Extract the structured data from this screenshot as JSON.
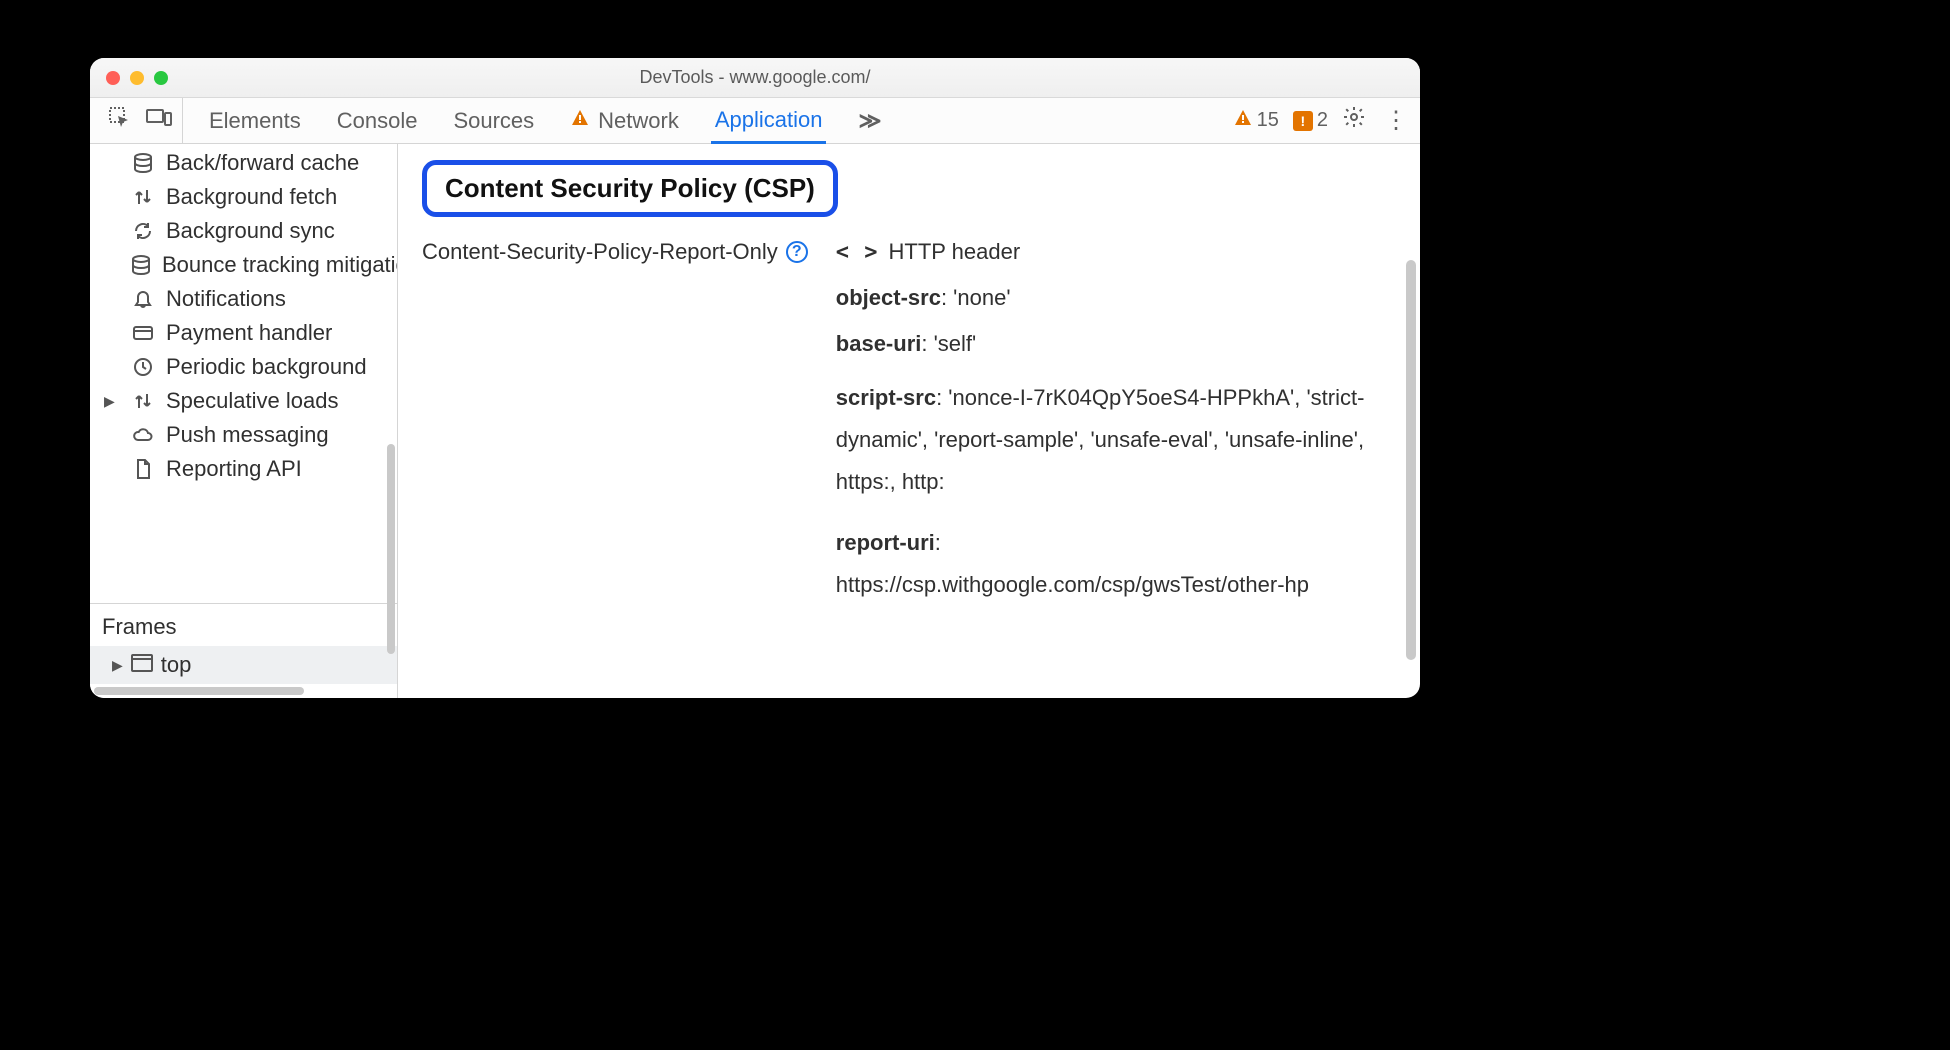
{
  "window": {
    "title": "DevTools - www.google.com/"
  },
  "tabstrip": {
    "tabs": [
      "Elements",
      "Console",
      "Sources",
      "Network",
      "Application"
    ],
    "active_index": 4,
    "overflow_glyph": "≫",
    "warn_count": "15",
    "issue_count": "2"
  },
  "sidebar": {
    "items": [
      {
        "icon": "database-icon",
        "label": "Back/forward cache"
      },
      {
        "icon": "updown-icon",
        "label": "Background fetch"
      },
      {
        "icon": "sync-icon",
        "label": "Background sync"
      },
      {
        "icon": "database-icon",
        "label": "Bounce tracking mitigation"
      },
      {
        "icon": "bell-icon",
        "label": "Notifications"
      },
      {
        "icon": "card-icon",
        "label": "Payment handler"
      },
      {
        "icon": "clock-icon",
        "label": "Periodic background"
      },
      {
        "icon": "updown-icon",
        "label": "Speculative loads",
        "expandable": true
      },
      {
        "icon": "cloud-icon",
        "label": "Push messaging"
      },
      {
        "icon": "file-icon",
        "label": "Reporting API"
      }
    ],
    "frames_header": "Frames",
    "frames_top": "top"
  },
  "main": {
    "heading": "Content Security Policy (CSP)",
    "left_label": "Content-Security-Policy-Report-Only",
    "source_label": "HTTP header",
    "directives": [
      {
        "name": "object-src",
        "value": "'none'"
      },
      {
        "name": "base-uri",
        "value": "'self'"
      },
      {
        "name": "script-src",
        "value": "'nonce-I-7rK04QpY5oeS4-HPPkhA', 'strict-dynamic', 'report-sample', 'unsafe-eval', 'unsafe-inline', https:, http:"
      },
      {
        "name": "report-uri",
        "value": "https://csp.withgoogle.com/csp/gwsTest/other-hp"
      }
    ]
  },
  "icons": {
    "database": "⛁",
    "updown": "⇅",
    "sync": "↻",
    "bell": "🔔",
    "card": "▭",
    "clock": "◷",
    "cloud": "☁",
    "file": "🗎",
    "window": "▭",
    "gear": "⚙",
    "kebab": "⋮",
    "warn": "▲",
    "inspect": "⯐",
    "devices": "🖥"
  }
}
